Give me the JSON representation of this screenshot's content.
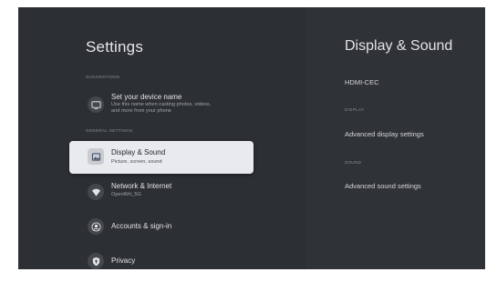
{
  "settings": {
    "title": "Settings",
    "sections": {
      "suggestions": "SUGGESTIONS",
      "general": "GENERAL SETTINGS"
    },
    "items": [
      {
        "title": "Set your device name",
        "subtitle": "Use this name when casting photos, videos,\nand more from your phone",
        "icon": "tv-icon"
      },
      {
        "title": "Display & Sound",
        "subtitle": "Picture, screen, sound",
        "icon": "picture-icon"
      },
      {
        "title": "Network & Internet",
        "subtitle": "OpenWrt_5G",
        "icon": "wifi-icon"
      },
      {
        "title": "Accounts & sign-in",
        "subtitle": "",
        "icon": "account-icon"
      },
      {
        "title": "Privacy",
        "subtitle": "",
        "icon": "shield-icon"
      }
    ]
  },
  "detail": {
    "title": "Display & Sound",
    "items": [
      {
        "type": "item",
        "label": "HDMI-CEC"
      },
      {
        "type": "section",
        "label": "DISPLAY"
      },
      {
        "type": "item",
        "label": "Advanced display settings"
      },
      {
        "type": "section",
        "label": "SOUND"
      },
      {
        "type": "item",
        "label": "Advanced sound settings"
      }
    ]
  },
  "colors": {
    "background": "#2c2f33",
    "panel": "#2f3236",
    "focused_row": "#e8eaed",
    "text_primary": "#e3e4e6",
    "text_secondary": "#a1a4a8"
  }
}
